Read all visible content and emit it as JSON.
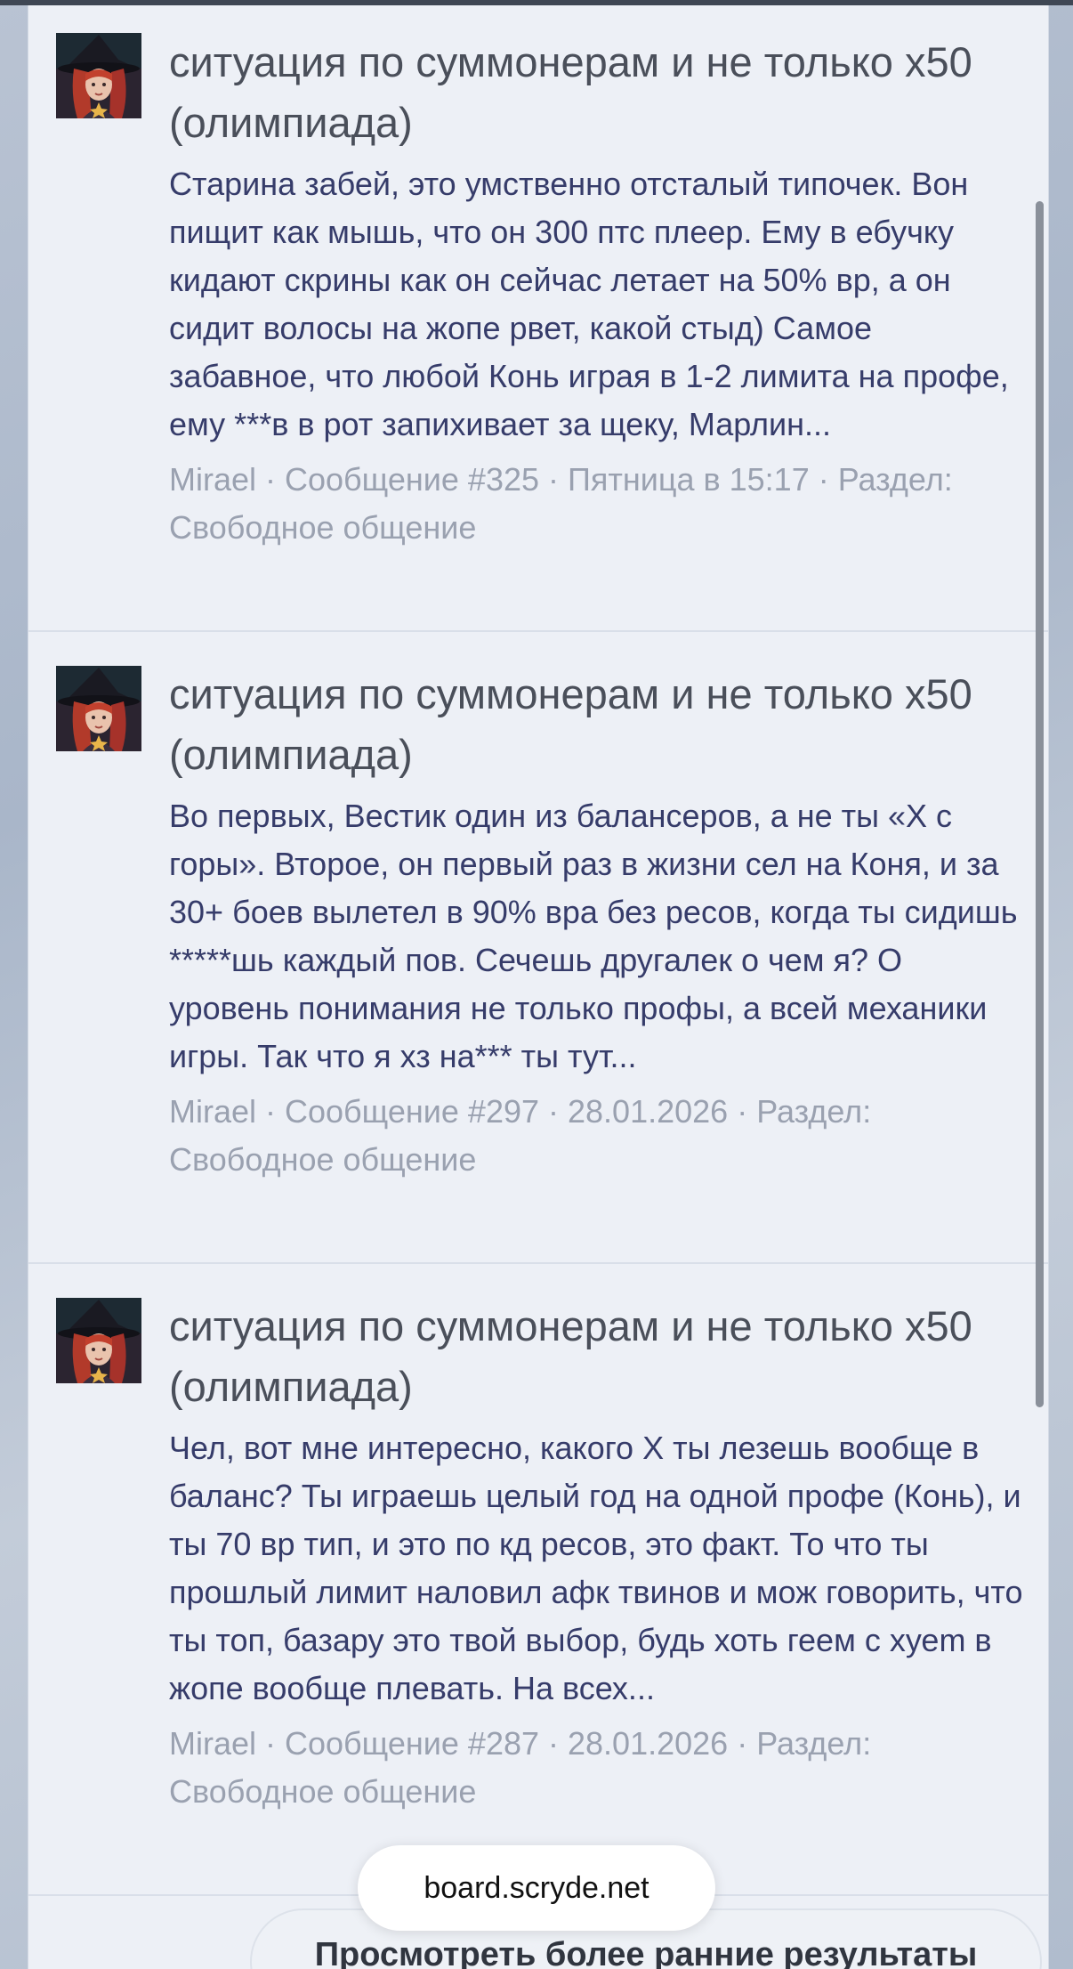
{
  "results": [
    {
      "title": "ситуация по суммонерам и не только x50 (олимпиада)",
      "snippet": "Старина забей, это умственно отсталый типочек. Вон пищит как мышь, что он 300 птс плеер. Ему в ебучку кидают скрины как он сейчас летает на 50% вр, а он сидит волосы на жопе рвет, какой стыд) Самое забавное, что любой Конь играя в 1-2 лимита на профе, ему ***в в рот запихивает за щеку, Марлин...",
      "author": "Mirael",
      "message": "Сообщение #325",
      "date": "Пятница в 15:17",
      "section_label": "Раздел:",
      "section": "Свободное общение"
    },
    {
      "title": "ситуация по суммонерам и не только x50 (олимпиада)",
      "snippet": "Во первых, Вестик один из балансеров, а не ты «Х с горы». Второе, он первый раз в жизни сел на Коня, и за 30+ боев вылетел в 90% вра без ресов, когда ты сидишь *****шь каждый пов. Сечешь другалек о чем я? О уровень понимания не только профы, а всей механики игры. Так что я хз на*** ты тут...",
      "author": "Mirael",
      "message": "Сообщение #297",
      "date": "28.01.2026",
      "section_label": "Раздел:",
      "section": "Свободное общение"
    },
    {
      "title": "ситуация по суммонерам и не только x50 (олимпиада)",
      "snippet": "Чел, вот мне интересно, какого Х ты лезешь вообще в баланс? Ты играешь целый год на одной профе (Конь), и ты 70 вр тип, и это по кд ресов, это факт. То что ты прошлый лимит наловил афк твинов и мож говорить, что ты топ, базару это твой выбор, будь хоть геем с хуеm в жопе вообще плевать. На всех...",
      "author": "Mirael",
      "message": "Сообщение #287",
      "date": "28.01.2026",
      "section_label": "Раздел:",
      "section": "Свободное общение"
    }
  ],
  "separator": " · ",
  "more_button": "Просмотреть более ранние результаты",
  "browser": {
    "url": "board.scryde.net"
  },
  "colors": {
    "panel": "#edf0f6",
    "title": "#4a4f5a",
    "snippet": "#363c6a",
    "meta": "#9aa1b0"
  },
  "icons": {
    "avatar": "witch-avatar"
  }
}
